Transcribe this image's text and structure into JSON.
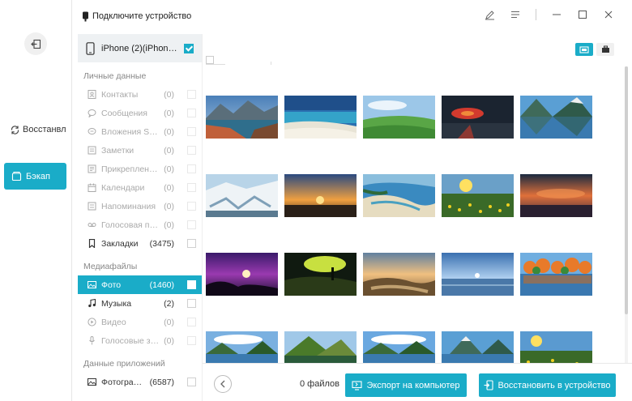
{
  "rail": {
    "restore_label": "Восстанвл",
    "backup_label": "Бэкап"
  },
  "header": {
    "title": "Подключите устройство"
  },
  "device": {
    "name": "iPhone (2)(iPhone..."
  },
  "sections": {
    "personal": "Личные данные",
    "media": "Медиафайлы",
    "apps": "Данные приложений"
  },
  "personal_items": [
    {
      "label": "Контакты",
      "count": "(0)",
      "icon": "contacts-icon"
    },
    {
      "label": "Сообщения",
      "count": "(0)",
      "icon": "messages-icon"
    },
    {
      "label": "Вложения SMS",
      "count": "(0)",
      "icon": "sms-attachments-icon"
    },
    {
      "label": "Заметки",
      "count": "(0)",
      "icon": "notes-icon"
    },
    {
      "label": "Прикрепленны...",
      "count": "(0)",
      "icon": "pinned-notes-icon"
    },
    {
      "label": "Календари",
      "count": "(0)",
      "icon": "calendar-icon"
    },
    {
      "label": "Напоминания",
      "count": "(0)",
      "icon": "reminders-icon"
    },
    {
      "label": "Голосовая почта",
      "count": "(0)",
      "icon": "voicemail-icon"
    },
    {
      "label": "Закладки",
      "count": "(3475)",
      "icon": "bookmark-icon"
    }
  ],
  "media_items": [
    {
      "label": "Фото",
      "count": "(1460)",
      "icon": "photo-icon"
    },
    {
      "label": "Музыка",
      "count": "(2)",
      "icon": "music-icon"
    },
    {
      "label": "Видео",
      "count": "(0)",
      "icon": "video-icon"
    },
    {
      "label": "Голосовые зам...",
      "count": "(0)",
      "icon": "voice-memo-icon"
    }
  ],
  "app_items": [
    {
      "label": "Фотографи...",
      "count": "(6587)",
      "icon": "app-photos-icon"
    }
  ],
  "footer": {
    "file_count": "0 файлов",
    "export_label": "Экспорт на компьютер",
    "restore_label": "Восстановить в устройство"
  },
  "colors": {
    "accent": "#1aacc8"
  }
}
